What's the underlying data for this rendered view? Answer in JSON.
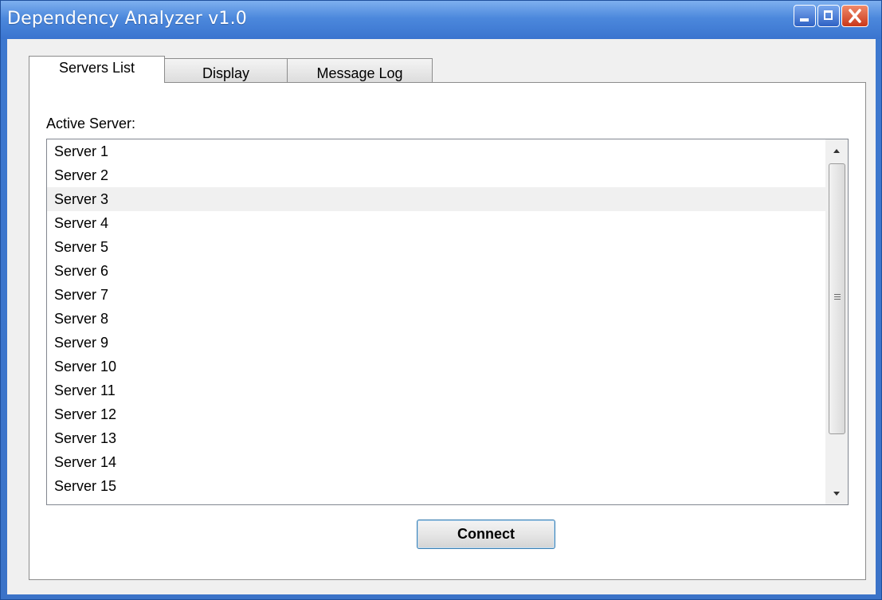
{
  "window": {
    "title": "Dependency Analyzer v1.0",
    "controls": [
      "minimize-icon",
      "maximize-icon",
      "close-icon"
    ]
  },
  "tabs": [
    {
      "label": "Servers List",
      "active": true
    },
    {
      "label": "Display",
      "active": false
    },
    {
      "label": "Message Log",
      "active": false
    }
  ],
  "servers_panel": {
    "label": "Active Server:",
    "items": [
      "Server 1",
      "Server 2",
      "Server 3",
      "Server 4",
      "Server 5",
      "Server 6",
      "Server 7",
      "Server 8",
      "Server 9",
      "Server 10",
      "Server 11",
      "Server 12",
      "Server 13",
      "Server 14",
      "Server 15"
    ],
    "hovered_item": "Server 3",
    "connect_label": "Connect"
  },
  "colors": {
    "titlebar": "#3a74cf",
    "close_button": "#c9381a",
    "hover_row": "#f0f0f0",
    "button_border": "#3c7fb1"
  }
}
